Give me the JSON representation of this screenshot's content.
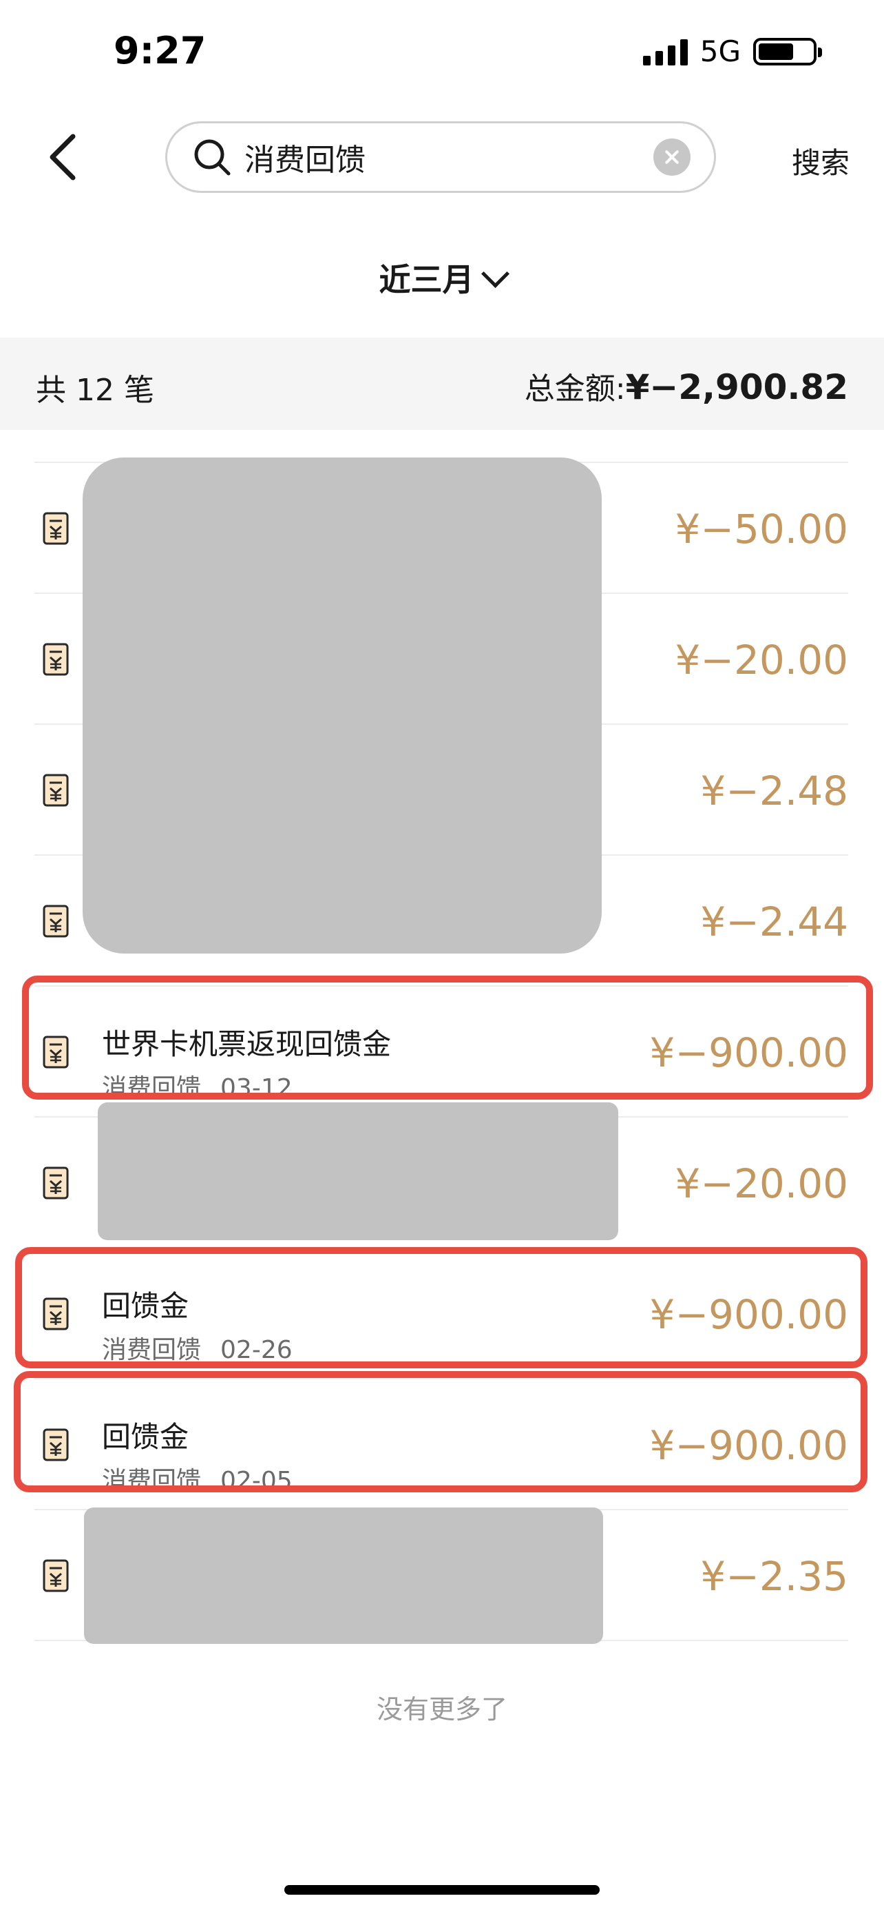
{
  "status_bar": {
    "time": "9:27",
    "network": "5G",
    "battery_level": 0.66
  },
  "nav": {
    "back_icon": "chevron-left-icon",
    "search_icon": "search-icon",
    "search_value": "消费回馈",
    "clear_icon": "clear-icon",
    "search_button": "搜索"
  },
  "filter": {
    "period_label": "近三月",
    "dropdown_icon": "chevron-down-icon"
  },
  "summary": {
    "count_label": "共 12 笔",
    "total_label": "总金额:",
    "total_value": "¥−2,900.82"
  },
  "transactions": [
    {
      "title": "",
      "category": "",
      "date": "",
      "amount": "¥−50.00",
      "redacted": true
    },
    {
      "title": "",
      "category": "",
      "date": "",
      "amount": "¥−20.00",
      "redacted": true
    },
    {
      "title": "",
      "category": "",
      "date": "",
      "amount": "¥−2.48",
      "redacted": true
    },
    {
      "title": "",
      "category": "",
      "date": "",
      "amount": "¥−2.44",
      "redacted": true
    },
    {
      "title": "世界卡机票返现回馈金",
      "category": "消费回馈",
      "date": "03-12",
      "amount": "¥−900.00",
      "highlighted": true
    },
    {
      "title": "",
      "category": "",
      "date": "",
      "amount": "¥−20.00",
      "redacted": true
    },
    {
      "title": "回馈金",
      "category": "消费回馈",
      "date": "02-26",
      "amount": "¥−900.00",
      "highlighted": true
    },
    {
      "title": "回馈金",
      "category": "消费回馈",
      "date": "02-05",
      "amount": "¥−900.00",
      "highlighted": true
    },
    {
      "title": "",
      "category": "",
      "date": "",
      "amount": "¥−2.35",
      "redacted": true
    }
  ],
  "list_end_text": "没有更多了",
  "colors": {
    "amount": "#c4975e",
    "highlight": "#e84b3f",
    "redaction": "#c2c2c2",
    "summary_bg": "#f5f5f5"
  }
}
